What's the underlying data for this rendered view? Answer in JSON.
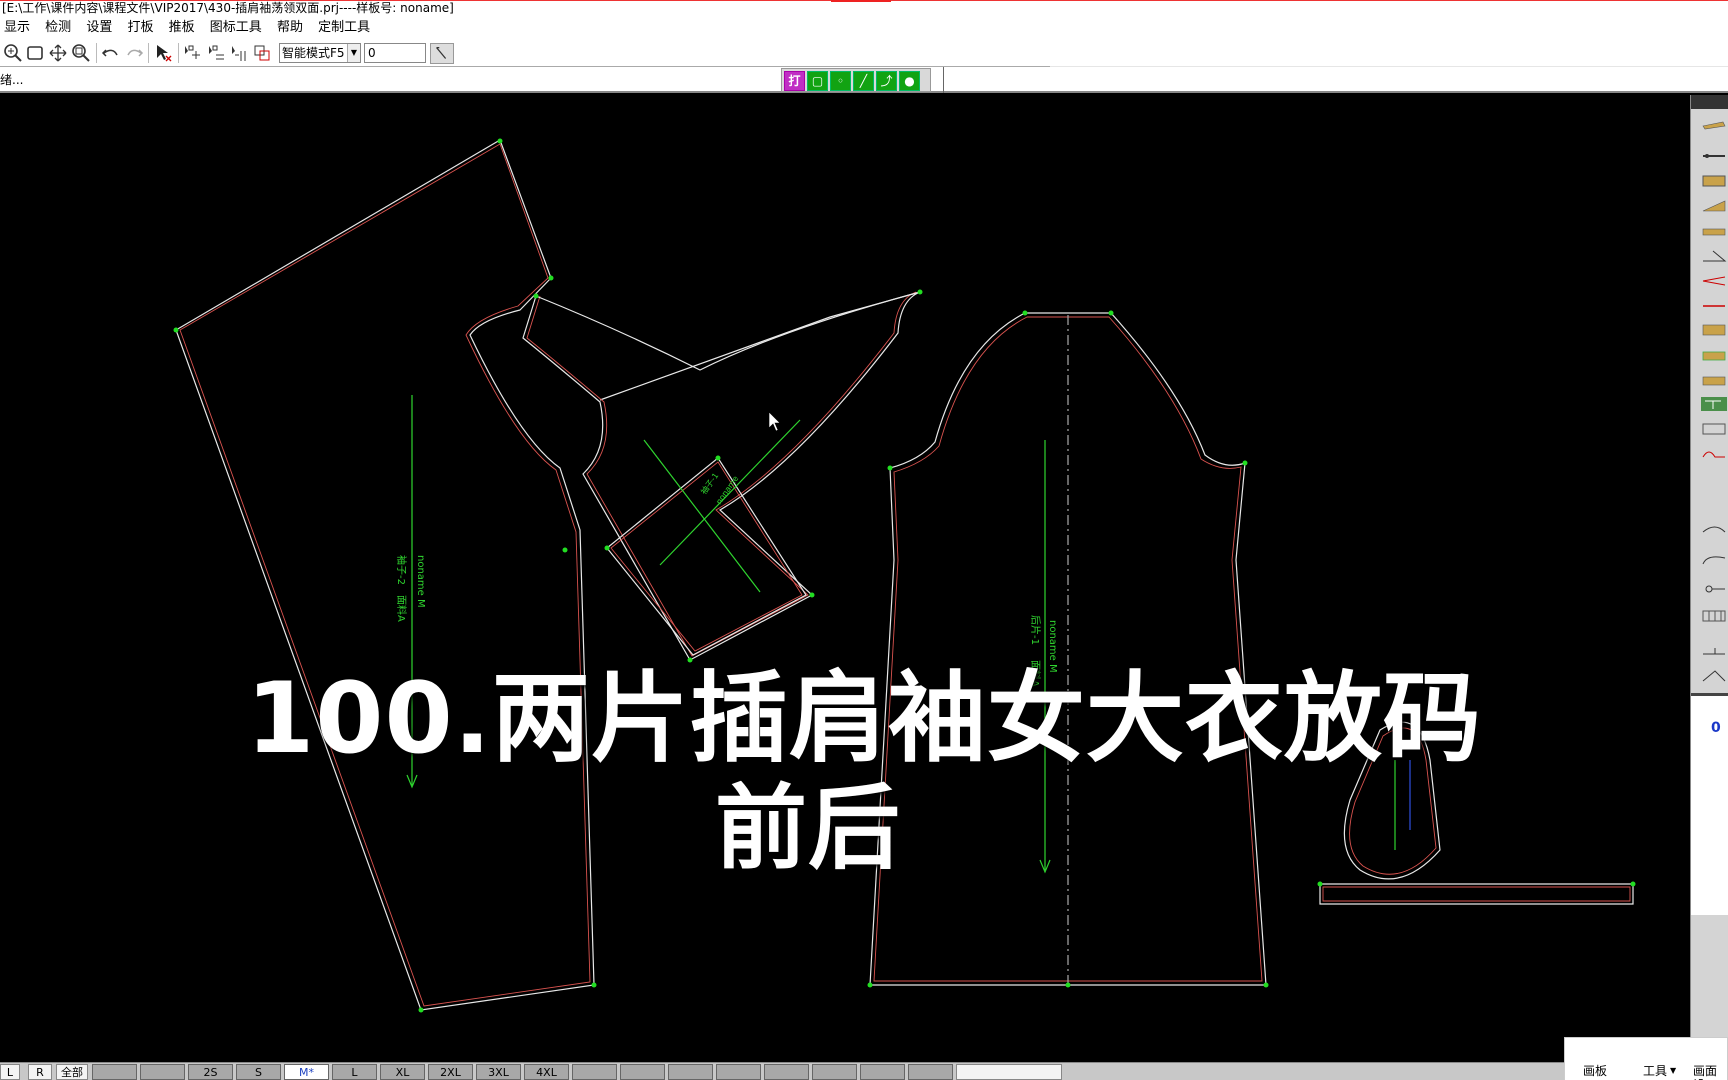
{
  "window": {
    "title": "[E:\\工作\\课件内容\\课程文件\\VIP2017\\430-插肩袖荡领双面.prj----样板号: noname]"
  },
  "menu": {
    "items": [
      "显示",
      "检测",
      "设置",
      "打板",
      "推板",
      "图标工具",
      "帮助",
      "定制工具"
    ]
  },
  "toolbar": {
    "mode_select": "智能模式F5",
    "value_field": "0",
    "icons": [
      "zoom-in-icon",
      "zoom-window-icon",
      "pan-icon",
      "zoom-fit-icon",
      "undo-icon",
      "redo-icon",
      "select-arrow-icon",
      "grade-point-icon",
      "grade-x-icon",
      "grade-y-icon",
      "grade-copy-icon"
    ]
  },
  "statusbar": {
    "text": "绪...",
    "green_tools": [
      "打",
      "▢",
      "◦",
      "╱",
      "⤴",
      "●"
    ]
  },
  "canvas": {
    "pieces": [
      {
        "name": "袖子-2",
        "info": "noname  M",
        "sub": "面料A"
      },
      {
        "name": "袖子-1",
        "info": "noname",
        "sub": "面料A"
      },
      {
        "name": "后片-1",
        "info": "noname  M",
        "sub": "面料A"
      }
    ]
  },
  "overlay": {
    "line1": "100.两片插肩袖女大衣放码",
    "line2": "前后"
  },
  "right_panel": {
    "counter": "0"
  },
  "sizes": {
    "left_tabs": [
      "L",
      "R",
      "全部"
    ],
    "labels": [
      "2S",
      "S",
      "M*",
      "L",
      "XL",
      "2XL",
      "3XL",
      "4XL"
    ],
    "base": "M*"
  },
  "bottom_tabs": [
    "画板",
    "工具",
    "画面设"
  ],
  "colors": {
    "canvas_bg": "#000000",
    "outline_white": "#e8e8e8",
    "outline_red": "#d9534f",
    "grain_green": "#2fd42f",
    "point_green": "#22dd22"
  }
}
